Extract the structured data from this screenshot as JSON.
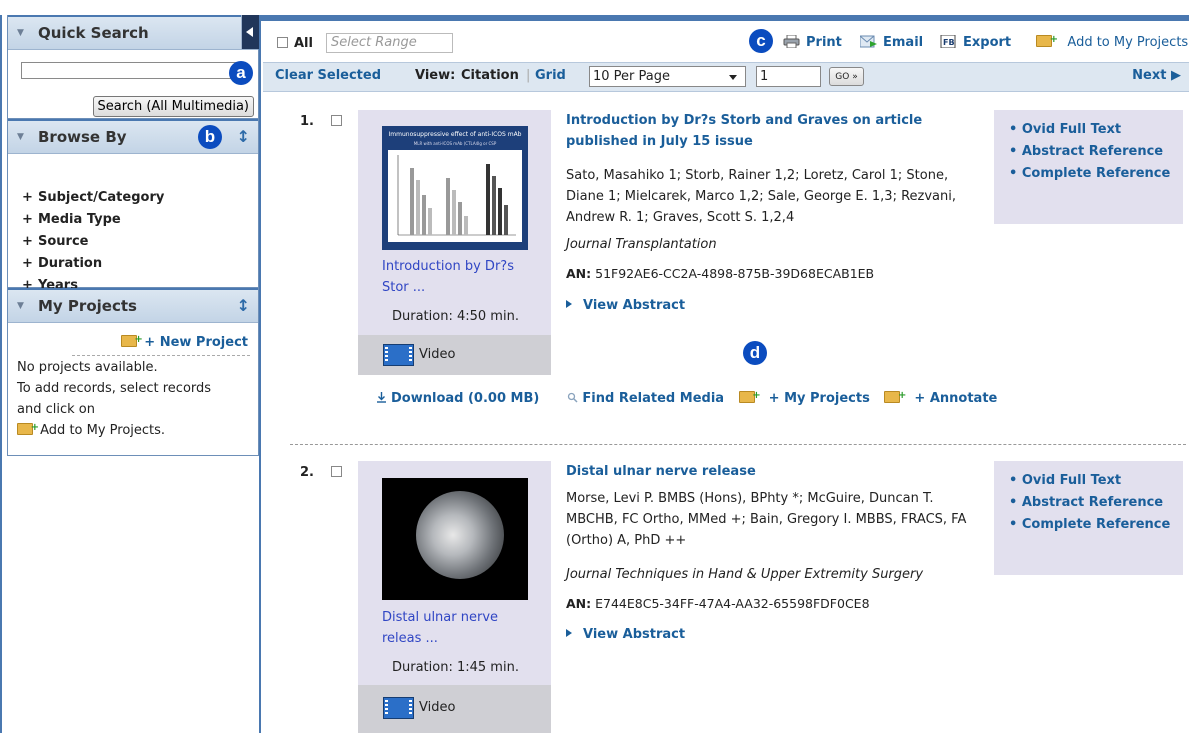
{
  "quick_search": {
    "title": "Quick Search",
    "input_value": "",
    "button_label": "Search (All Multimedia)",
    "callout": "a"
  },
  "browse_by": {
    "title": "Browse By",
    "callout": "b",
    "items": [
      "Subject/Category",
      "Media Type",
      "Source",
      "Duration",
      "Years"
    ]
  },
  "my_projects": {
    "title": "My Projects",
    "new_project": "+ New Project",
    "lines": [
      "No projects available.",
      "To add records, select records",
      "and click on",
      "Add to My Projects."
    ]
  },
  "toolbar": {
    "all_label": "All",
    "range_placeholder": "Select Range",
    "callout": "c",
    "print": "Print",
    "email": "Email",
    "export": "Export",
    "add_projects": "Add to My Projects"
  },
  "viewbar": {
    "clear_selected": "Clear Selected",
    "view_label": "View:",
    "citation": "Citation",
    "grid": "Grid",
    "per_page": "10 Per Page",
    "page_number": "1",
    "go_label": "GO »",
    "next": "Next"
  },
  "results": [
    {
      "number": "1.",
      "thumb_caption": "Immunosuppressive effect of anti-ICOS mAb",
      "thumb_subcaption": "MLR with anti-ICOS mAb (CTLA4Ig or CSP",
      "thumb_link": "Introduction by Dr?s Stor ...",
      "duration": "Duration: 4:50 min.",
      "media_type": "Video",
      "title": "Introduction by Dr?s Storb and Graves on article published in July 15 issue",
      "authors": "Sato, Masahiko 1; Storb, Rainer 1,2; Loretz, Carol 1; Stone, Diane 1; Mielcarek, Marco 1,2; Sale, George E. 1,3; Rezvani, Andrew R. 1; Graves, Scott S. 1,2,4",
      "journal": "Journal Transplantation",
      "an_label": "AN:",
      "an_value": "51F92AE6-CC2A-4898-875B-39D68ECAB1EB",
      "view_abstract": "View Abstract",
      "links": [
        "Ovid Full Text",
        "Abstract Reference",
        "Complete Reference"
      ]
    },
    {
      "number": "2.",
      "thumb_link": "Distal ulnar nerve releas ...",
      "duration": "Duration: 1:45 min.",
      "media_type": "Video",
      "title": "Distal ulnar nerve release",
      "authors": "Morse, Levi P. BMBS (Hons), BPhty *; McGuire, Duncan T. MBCHB, FC Ortho, MMed +; Bain, Gregory I. MBBS, FRACS, FA (Ortho) A, PhD ++",
      "journal": "Journal Techniques in Hand & Upper Extremity Surgery",
      "an_label": "AN:",
      "an_value": "E744E8C5-34FF-47A4-AA32-65598FDF0CE8",
      "view_abstract": "View Abstract",
      "links": [
        "Ovid Full Text",
        "Abstract Reference",
        "Complete Reference"
      ]
    }
  ],
  "result_actions": {
    "download": "Download (0.00 MB)",
    "related": "Find Related Media",
    "my_projects": "+ My Projects",
    "annotate": "+  Annotate",
    "callout": "d"
  },
  "colors": {
    "link": "#1a5e9a",
    "callout": "#0b4cbf",
    "panel_border": "#4a78b0",
    "card_bg": "#e2e0ee"
  },
  "icons": [
    "collapse-left-icon",
    "resize-icon",
    "print-icon",
    "email-icon",
    "export-icon",
    "add-folder-icon",
    "download-icon",
    "search-icon",
    "video-icon",
    "next-arrow-icon"
  ]
}
